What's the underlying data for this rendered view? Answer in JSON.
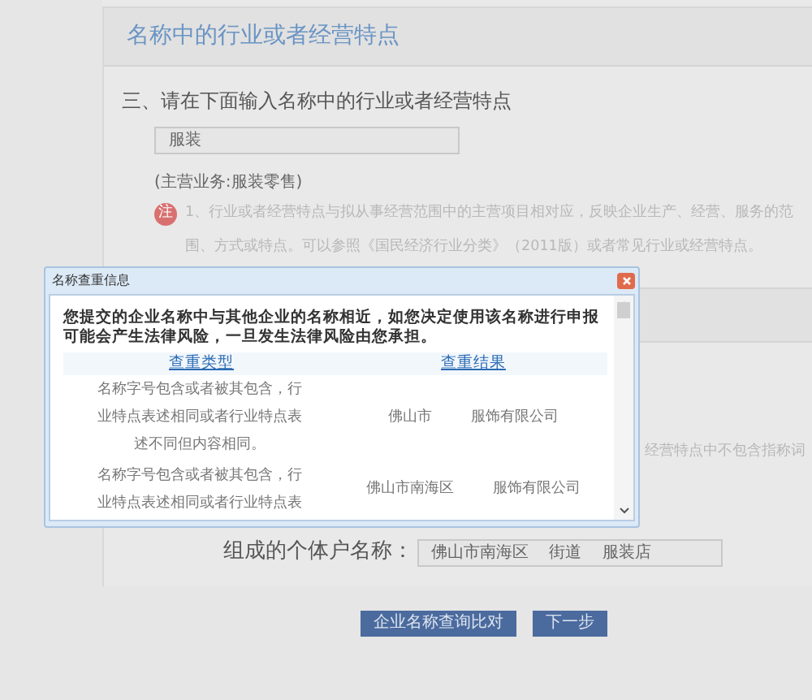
{
  "section": {
    "title": "名称中的行业或者经营特点",
    "prompt": "三、请在下面输入名称中的行业或者经营特点",
    "industry_input": {
      "value": "服装"
    },
    "main_business": "(主营业务:服装零售)",
    "note_icon": "注",
    "note": "1、行业或者经营特点与拟从事经营范围中的主营项目相对应，反映企业生产、经营、服务的范围、方式或特点。可以参照《国民经济行业分类》（2011版）或者常见行业或经营特点。",
    "hidden_hint": "经营特点中不包含指称词"
  },
  "dialog": {
    "title": "名称查重信息",
    "warning": "您提交的企业名称中与其他企业的名称相近，如您决定使用该名称进行申报可能会产生法律风险，一旦发生法律风险由您承担。",
    "columns": [
      "查重类型",
      "查重结果"
    ],
    "rows": [
      {
        "type": "名称字号包含或者被其包含，行业特点表述相同或者行业特点表述不同但内容相同。",
        "results": [
          "佛山市",
          "服饰有限公司"
        ]
      },
      {
        "type": "名称字号包含或者被其包含，行业特点表述相同或者行业特点表",
        "results": [
          "佛山市南海区",
          "服饰有限公司"
        ]
      }
    ]
  },
  "composed_name": {
    "label": "组成的个体户名称：",
    "value": "佛山市南海区    街道    服装店"
  },
  "buttons": [
    "企业名称查询比对",
    "下一步"
  ]
}
